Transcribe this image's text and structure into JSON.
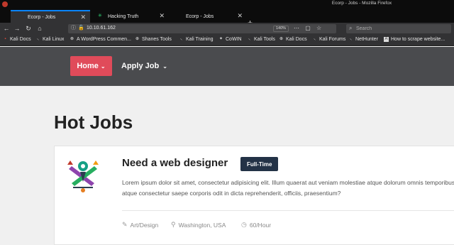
{
  "window": {
    "title": "Ecorp - Jobs - Mozilla Firefox"
  },
  "tabs": [
    {
      "label": "Ecorp - Jobs",
      "active": true
    },
    {
      "label": "Hacking Truth",
      "active": false
    },
    {
      "label": "Ecorp - Jobs",
      "active": false
    }
  ],
  "toolbar": {
    "url": "10.10.61.162",
    "zoom": "140%",
    "search_placeholder": "Search"
  },
  "bookmarks": [
    {
      "label": "Kali Docs",
      "icon": "kali-icon"
    },
    {
      "label": "Kali Linux",
      "icon": "kali-icon"
    },
    {
      "label": "A WordPress Commen...",
      "icon": "wordpress-icon"
    },
    {
      "label": "Shanes Tools",
      "icon": "globe-icon"
    },
    {
      "label": "Kali Training",
      "icon": "kali-icon"
    },
    {
      "label": "CoWIN",
      "icon": "shield-icon"
    },
    {
      "label": "Kali Tools",
      "icon": "kali-icon"
    },
    {
      "label": "Kali Docs",
      "icon": "globe-icon"
    },
    {
      "label": "Kali Forums",
      "icon": "kali-icon"
    },
    {
      "label": "NetHunter",
      "icon": "kali-icon"
    },
    {
      "label": "How to scrape website...",
      "icon": "page-icon"
    }
  ],
  "site": {
    "nav": {
      "home": "Home",
      "apply": "Apply Job"
    },
    "page_title": "Hot Jobs",
    "job": {
      "title": "Need a web designer",
      "badge": "Full-Time",
      "description_line1": "Lorem ipsum dolor sit amet, consectetur adipisicing elit. Illum quaerat aut veniam molestiae atque dolorum omnis temporibus consequuntur saepe. Nemo",
      "description_line2": "atque consectetur saepe corporis odit in dicta reprehenderit, officiis, praesentium?",
      "category": "Art/Design",
      "location": "Washington, USA",
      "rate": "60/Hour"
    }
  },
  "colors": {
    "accent": "#e04b5a",
    "header_bg": "#4a4b4e",
    "badge_bg": "#233246"
  }
}
